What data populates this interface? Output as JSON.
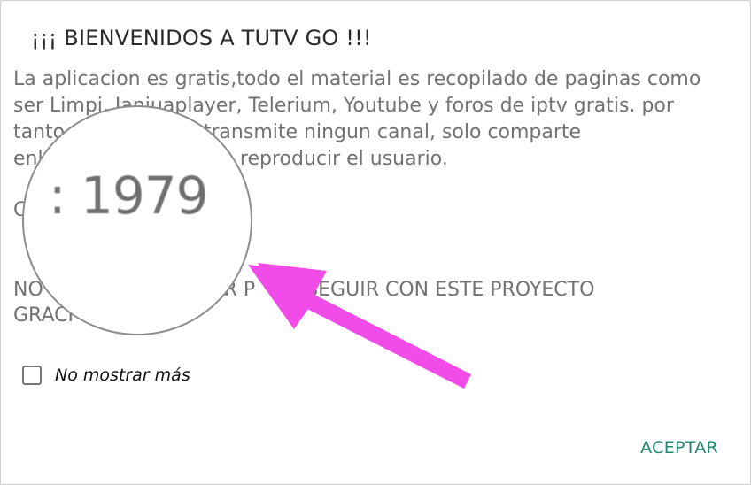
{
  "dialog": {
    "title": "¡¡¡ BIENVENIDOS A TUTV GO !!!",
    "body_lines": [
      "La aplicacion es gratis,todo el material es recopilado de paginas como",
      "ser Limpi, Ianiuaplayer, Telerium, Youtube y foros de iptv gratis. por",
      "tanto          aloja ni transmite ningun canal, solo comparte",
      "enl                ue puede reproducir el usuario."
    ],
    "line_c": "C",
    "notice_lines": [
      "NO                           AR P     A SEGUIR CON ESTE PROYECTO",
      "GRACI"
    ],
    "checkbox_label": "No mostrar más",
    "accept_label": "ACEPTAR"
  },
  "magnifier": {
    "text": ": 1979"
  },
  "colors": {
    "accent": "#1f8a70",
    "annotation_arrow": "#f24ce8",
    "body_text": "#727272"
  }
}
